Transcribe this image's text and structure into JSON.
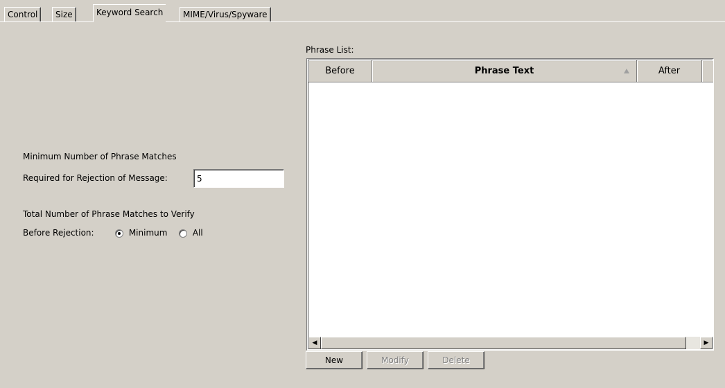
{
  "tabs": [
    {
      "label": "Control"
    },
    {
      "label": "Size"
    },
    {
      "label": "Keyword Search",
      "active": true
    },
    {
      "label": "MIME/Virus/Spyware"
    }
  ],
  "left": {
    "min_matches_line1": "Minimum Number of Phrase Matches",
    "min_matches_line2": "Required for Rejection of Message:",
    "min_matches_value": "5",
    "verify_line1": "Total Number of Phrase Matches to Verify",
    "verify_line2": "Before Rejection:",
    "radio_minimum": "Minimum",
    "radio_all": "All",
    "selected": "Minimum"
  },
  "phrase_list": {
    "label": "Phrase List:",
    "columns": [
      "Before",
      "Phrase Text",
      "After"
    ],
    "sorted_column": "Phrase Text",
    "rows": []
  },
  "buttons": {
    "new": "New",
    "modify": "Modify",
    "delete": "Delete"
  }
}
